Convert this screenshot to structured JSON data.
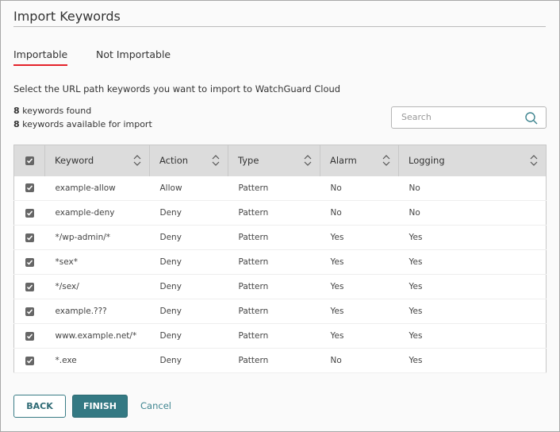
{
  "title": "Import Keywords",
  "tabs": [
    {
      "label": "Importable",
      "active": true
    },
    {
      "label": "Not Importable",
      "active": false
    }
  ],
  "description": "Select the URL path keywords you want to import to WatchGuard Cloud",
  "counts": {
    "found_num": "8",
    "found_text": " keywords found",
    "available_num": "8",
    "available_text": " keywords available for import"
  },
  "search": {
    "placeholder": "Search",
    "icon": "search-icon"
  },
  "table": {
    "headers": [
      "Keyword",
      "Action",
      "Type",
      "Alarm",
      "Logging"
    ],
    "rows": [
      {
        "keyword": "example-allow",
        "action": "Allow",
        "type": "Pattern",
        "alarm": "No",
        "logging": "No",
        "checked": true
      },
      {
        "keyword": "example-deny",
        "action": "Deny",
        "type": "Pattern",
        "alarm": "No",
        "logging": "No",
        "checked": true
      },
      {
        "keyword": "*/wp-admin/*",
        "action": "Deny",
        "type": "Pattern",
        "alarm": "Yes",
        "logging": "Yes",
        "checked": true
      },
      {
        "keyword": "*sex*",
        "action": "Deny",
        "type": "Pattern",
        "alarm": "Yes",
        "logging": "Yes",
        "checked": true
      },
      {
        "keyword": "*/sex/",
        "action": "Deny",
        "type": "Pattern",
        "alarm": "Yes",
        "logging": "Yes",
        "checked": true
      },
      {
        "keyword": "example.???",
        "action": "Deny",
        "type": "Pattern",
        "alarm": "Yes",
        "logging": "Yes",
        "checked": true
      },
      {
        "keyword": "www.example.net/*",
        "action": "Deny",
        "type": "Pattern",
        "alarm": "Yes",
        "logging": "Yes",
        "checked": true
      },
      {
        "keyword": "*.exe",
        "action": "Deny",
        "type": "Pattern",
        "alarm": "No",
        "logging": "Yes",
        "checked": true
      }
    ]
  },
  "buttons": {
    "back": "BACK",
    "finish": "FINISH",
    "cancel": "Cancel"
  },
  "colors": {
    "accent": "#347983",
    "tab_underline": "#e4222a"
  }
}
